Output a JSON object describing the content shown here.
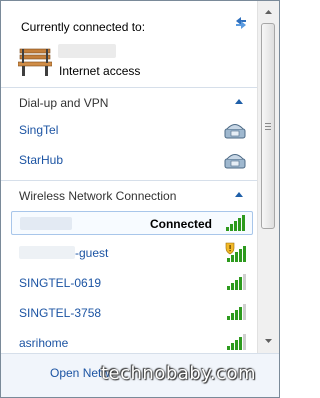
{
  "header": {
    "title": "Currently connected to:",
    "access": "Internet access"
  },
  "sections": {
    "dialup": {
      "label": "Dial-up and VPN"
    },
    "wireless": {
      "label": "Wireless Network Connection"
    }
  },
  "dialup_items": [
    {
      "name": "SingTel",
      "icon": "phone-modem-icon"
    },
    {
      "name": "StarHub",
      "icon": "phone-modem-icon"
    }
  ],
  "wireless_items": [
    {
      "name": "",
      "status": "Connected",
      "icon": "signal-strength-icon"
    },
    {
      "name_suffix": "-guest",
      "icon": "signal-shield-icon"
    },
    {
      "name": "SINGTEL-0619",
      "icon": "signal-strength-icon"
    },
    {
      "name": "SINGTEL-3758",
      "icon": "signal-strength-icon"
    },
    {
      "name": "asrihome",
      "icon": "signal-strength-icon"
    }
  ],
  "footer": {
    "link": "Open Netw",
    "watermark": "technobaby.com"
  },
  "colors": {
    "link": "#1c54a3",
    "signal": "#2d9a1e",
    "accent": "#1f5fa8"
  }
}
